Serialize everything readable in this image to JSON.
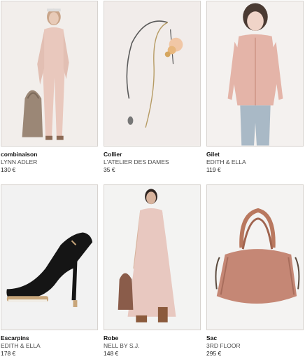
{
  "products": [
    {
      "title": "combinaison",
      "brand": "LYNN ADLER",
      "price": "130 €",
      "image_icon": "jumpsuit-photo"
    },
    {
      "title": "Collier",
      "brand": "L'ATELIER DES DAMES",
      "price": "35 €",
      "image_icon": "necklace-photo"
    },
    {
      "title": "Gilet",
      "brand": "EDITH & ELLA",
      "price": "119 €",
      "image_icon": "cardigan-photo"
    },
    {
      "title": "Escarpins",
      "brand": "EDITH & ELLA",
      "price": "178 €",
      "image_icon": "pumps-photo"
    },
    {
      "title": "Robe",
      "brand": "NELL BY S.J.",
      "price": "148 €",
      "image_icon": "dress-photo"
    },
    {
      "title": "Sac",
      "brand": "3RD FLOOR",
      "price": "295 €",
      "image_icon": "handbag-photo"
    }
  ]
}
